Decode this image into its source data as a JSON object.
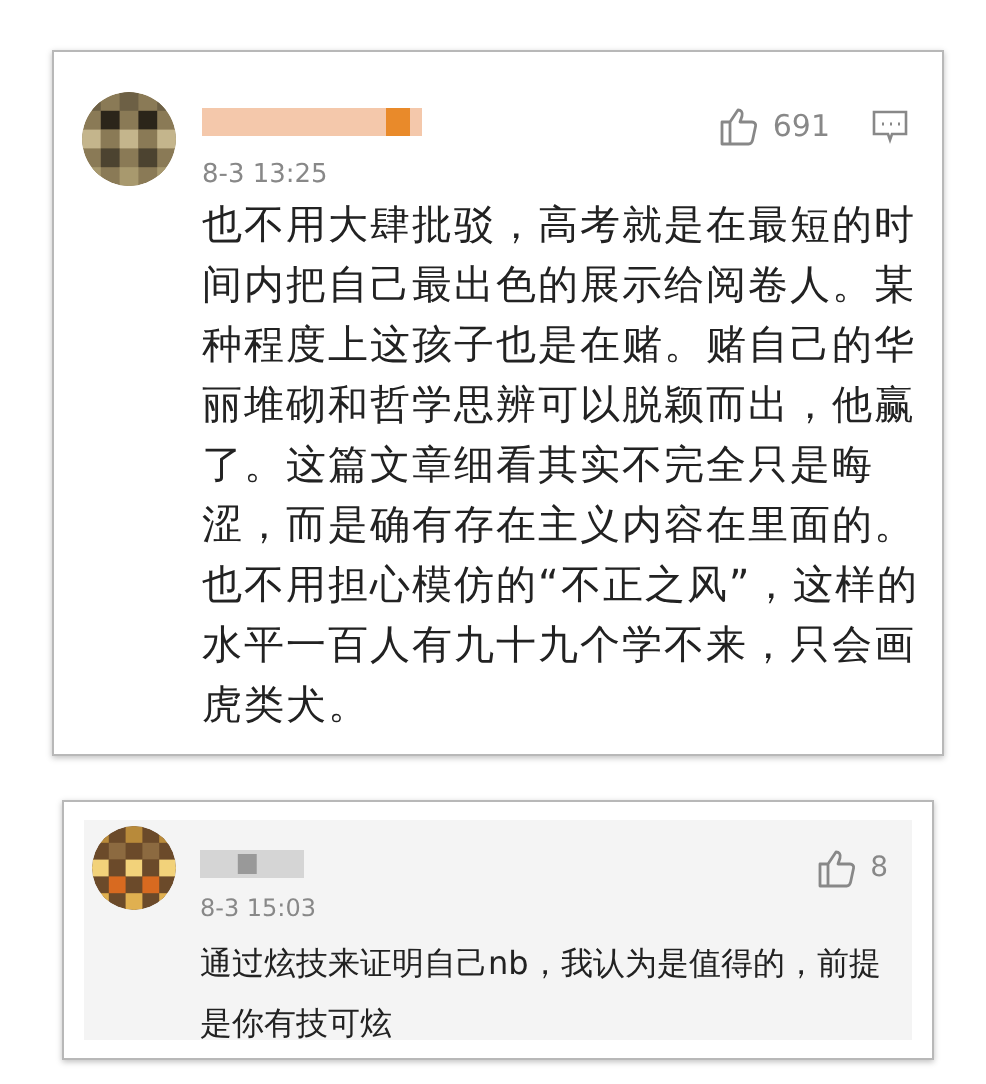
{
  "comments": [
    {
      "kind": "main",
      "time": "8-3 13:25",
      "likes": "691",
      "text": "也不用大肆批驳，高考就是在最短的时间内把自己最出色的展示给阅卷人。某种程度上这孩子也是在赌。赌自己的华丽堆砌和哲学思辨可以脱颖而出，他赢了。这篇文章细看其实不完全只是晦涩，而是确有存在主义内容在里面的。也不用担心模仿的“不正之风”，这样的水平一百人有九十九个学不来，只会画虎类犬。"
    },
    {
      "kind": "nested",
      "time": "8-3 15:03",
      "likes": "8",
      "text": "通过炫技来证明自己nb，我认为是值得的，前提是你有技可炫"
    }
  ]
}
